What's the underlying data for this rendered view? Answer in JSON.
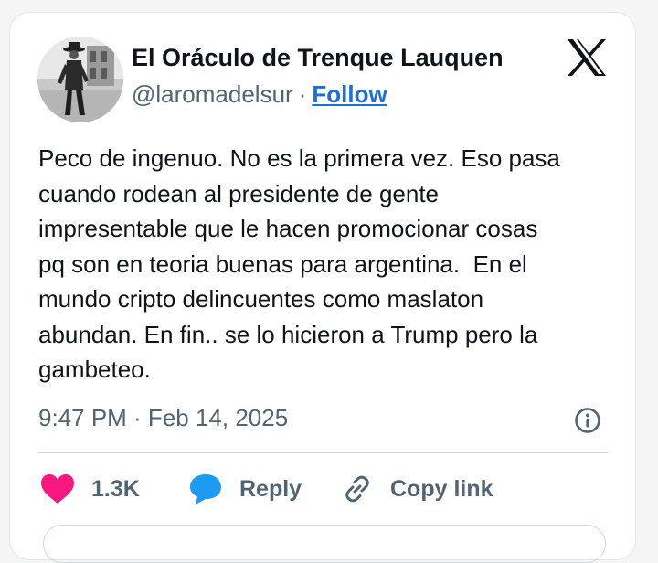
{
  "author": {
    "display_name": "El Oráculo de Trenque Lauquen",
    "handle": "@laromadelsur",
    "separator": "·",
    "follow_label": "Follow"
  },
  "tweet": {
    "text": "Peco de ingenuo. No es la primera vez. Eso pasa\ncuando rodean al presidente de gente\nimpresentable que le hacen promocionar cosas\npq son en teoria buenas para argentina.  En el\nmundo cripto delincuentes como maslaton\nabundan. En fin.. se lo hicieron a Trump pero la\ngambeteo.",
    "timestamp": "9:47 PM · Feb 14, 2025"
  },
  "actions": {
    "like_count": "1.3K",
    "reply_label": "Reply",
    "copy_link_label": "Copy link"
  },
  "icons": {
    "brand": "x-logo-icon",
    "info": "info-icon",
    "like": "heart-icon",
    "reply": "speech-bubble-icon",
    "copy": "link-icon"
  },
  "colors": {
    "like": "#f91880",
    "reply": "#1d9bf0",
    "follow": "#1d6fd1",
    "secondary_text": "#536471",
    "primary_text": "#0f1419"
  }
}
